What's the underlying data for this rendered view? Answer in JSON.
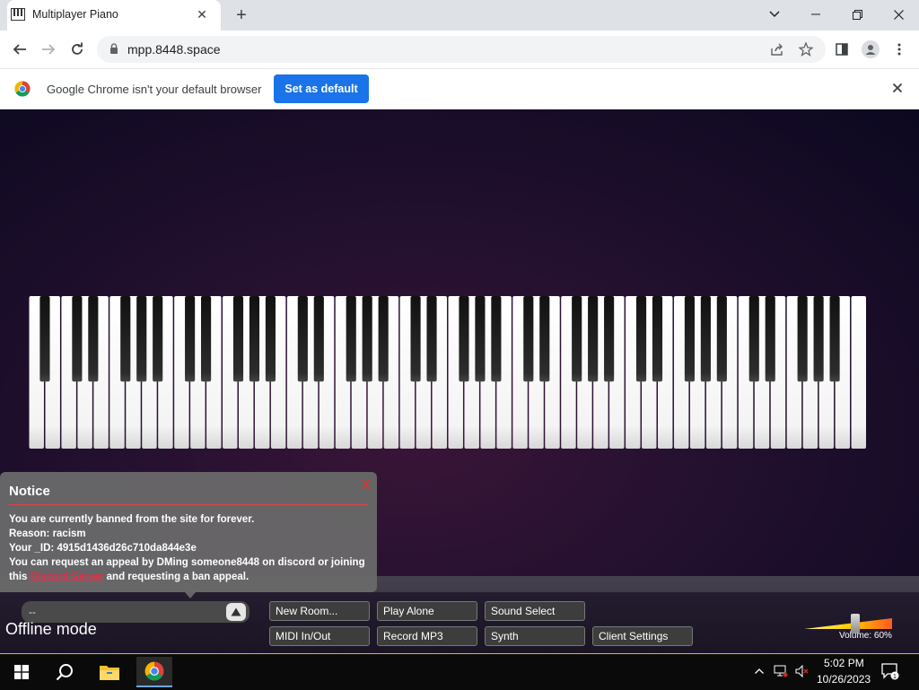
{
  "browser": {
    "tab_title": "Multiplayer Piano",
    "url": "mpp.8448.space",
    "new_tab_symbol": "+",
    "tab_close_symbol": "✕"
  },
  "infobar": {
    "message": "Google Chrome isn't your default browser",
    "button_label": "Set as default"
  },
  "notice": {
    "title": "Notice",
    "close_label": "X",
    "line1": "You are currently banned from the site for forever.",
    "line2": "Reason: racism",
    "line3": "Your _ID: 4915d1436d26c710da844e3e",
    "line4": "You can request an appeal by DMing someone8448 on discord or joining",
    "line5_prefix": "this ",
    "link_text": "Discord Server",
    "line5_suffix": " and requesting a ban appeal."
  },
  "controls": {
    "room_value": "--",
    "offline_label": "Offline mode",
    "buttons": {
      "new_room": "New Room...",
      "play_alone": "Play Alone",
      "sound_select": "Sound Select",
      "midi": "MIDI In/Out",
      "record": "Record MP3",
      "synth": "Synth",
      "client_settings": "Client Settings"
    },
    "volume_label": "Volume: 60%",
    "volume_level": 0.6
  },
  "piano": {
    "white_key_count": 52
  },
  "taskbar": {
    "time": "5:02 PM",
    "date": "10/26/2023",
    "notification_count": "1"
  },
  "colors": {
    "accent_blue": "#1a73e8",
    "notice_close": "#e03030",
    "link": "#e0304a"
  }
}
